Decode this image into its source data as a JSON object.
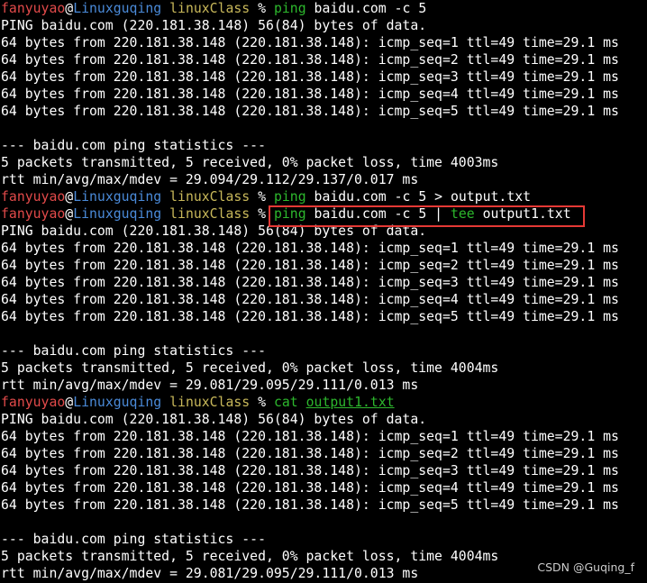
{
  "prompt": {
    "user": "fanyuyao",
    "at": "@",
    "host": "Linuxguqing",
    "dir": "linuxClass",
    "symbol": "%"
  },
  "commands": {
    "c1_cmd": "ping",
    "c1_args": " baidu.com -c 5",
    "c2_cmd": "ping",
    "c2_args": " baidu.com -c 5 > output.txt",
    "c3_cmd": "ping",
    "c3_args": " baidu.com -c 5 | ",
    "c3_tee": "tee",
    "c3_file": " output1.txt",
    "c4_cmd": "cat",
    "c4_file": "output1.txt"
  },
  "run1": {
    "header": "PING baidu.com (220.181.38.148) 56(84) bytes of data.",
    "replies": [
      "64 bytes from 220.181.38.148 (220.181.38.148): icmp_seq=1 ttl=49 time=29.1 ms",
      "64 bytes from 220.181.38.148 (220.181.38.148): icmp_seq=2 ttl=49 time=29.1 ms",
      "64 bytes from 220.181.38.148 (220.181.38.148): icmp_seq=3 ttl=49 time=29.1 ms",
      "64 bytes from 220.181.38.148 (220.181.38.148): icmp_seq=4 ttl=49 time=29.1 ms",
      "64 bytes from 220.181.38.148 (220.181.38.148): icmp_seq=5 ttl=49 time=29.1 ms"
    ],
    "stats_title": "--- baidu.com ping statistics ---",
    "stats_packets": "5 packets transmitted, 5 received, 0% packet loss, time 4003ms",
    "stats_rtt": "rtt min/avg/max/mdev = 29.094/29.112/29.137/0.017 ms"
  },
  "run2": {
    "header": "PING baidu.com (220.181.38.148) 56(84) bytes of data.",
    "replies": [
      "64 bytes from 220.181.38.148 (220.181.38.148): icmp_seq=1 ttl=49 time=29.1 ms",
      "64 bytes from 220.181.38.148 (220.181.38.148): icmp_seq=2 ttl=49 time=29.1 ms",
      "64 bytes from 220.181.38.148 (220.181.38.148): icmp_seq=3 ttl=49 time=29.1 ms",
      "64 bytes from 220.181.38.148 (220.181.38.148): icmp_seq=4 ttl=49 time=29.1 ms",
      "64 bytes from 220.181.38.148 (220.181.38.148): icmp_seq=5 ttl=49 time=29.1 ms"
    ],
    "stats_title": "--- baidu.com ping statistics ---",
    "stats_packets": "5 packets transmitted, 5 received, 0% packet loss, time 4004ms",
    "stats_rtt": "rtt min/avg/max/mdev = 29.081/29.095/29.111/0.013 ms"
  },
  "run3": {
    "header": "PING baidu.com (220.181.38.148) 56(84) bytes of data.",
    "replies": [
      "64 bytes from 220.181.38.148 (220.181.38.148): icmp_seq=1 ttl=49 time=29.1 ms",
      "64 bytes from 220.181.38.148 (220.181.38.148): icmp_seq=2 ttl=49 time=29.1 ms",
      "64 bytes from 220.181.38.148 (220.181.38.148): icmp_seq=3 ttl=49 time=29.1 ms",
      "64 bytes from 220.181.38.148 (220.181.38.148): icmp_seq=4 ttl=49 time=29.1 ms",
      "64 bytes from 220.181.38.148 (220.181.38.148): icmp_seq=5 ttl=49 time=29.1 ms"
    ],
    "stats_title": "--- baidu.com ping statistics ---",
    "stats_packets": "5 packets transmitted, 5 received, 0% packet loss, time 4004ms",
    "stats_rtt": "rtt min/avg/max/mdev = 29.081/29.095/29.111/0.013 ms"
  },
  "watermark": "CSDN @Guqing_f",
  "colors": {
    "background": "#000000",
    "user": "#e24a4a",
    "host": "#4a8ad8",
    "dir": "#c8b85a",
    "command": "#2db82d",
    "highlight": "#e53935"
  }
}
